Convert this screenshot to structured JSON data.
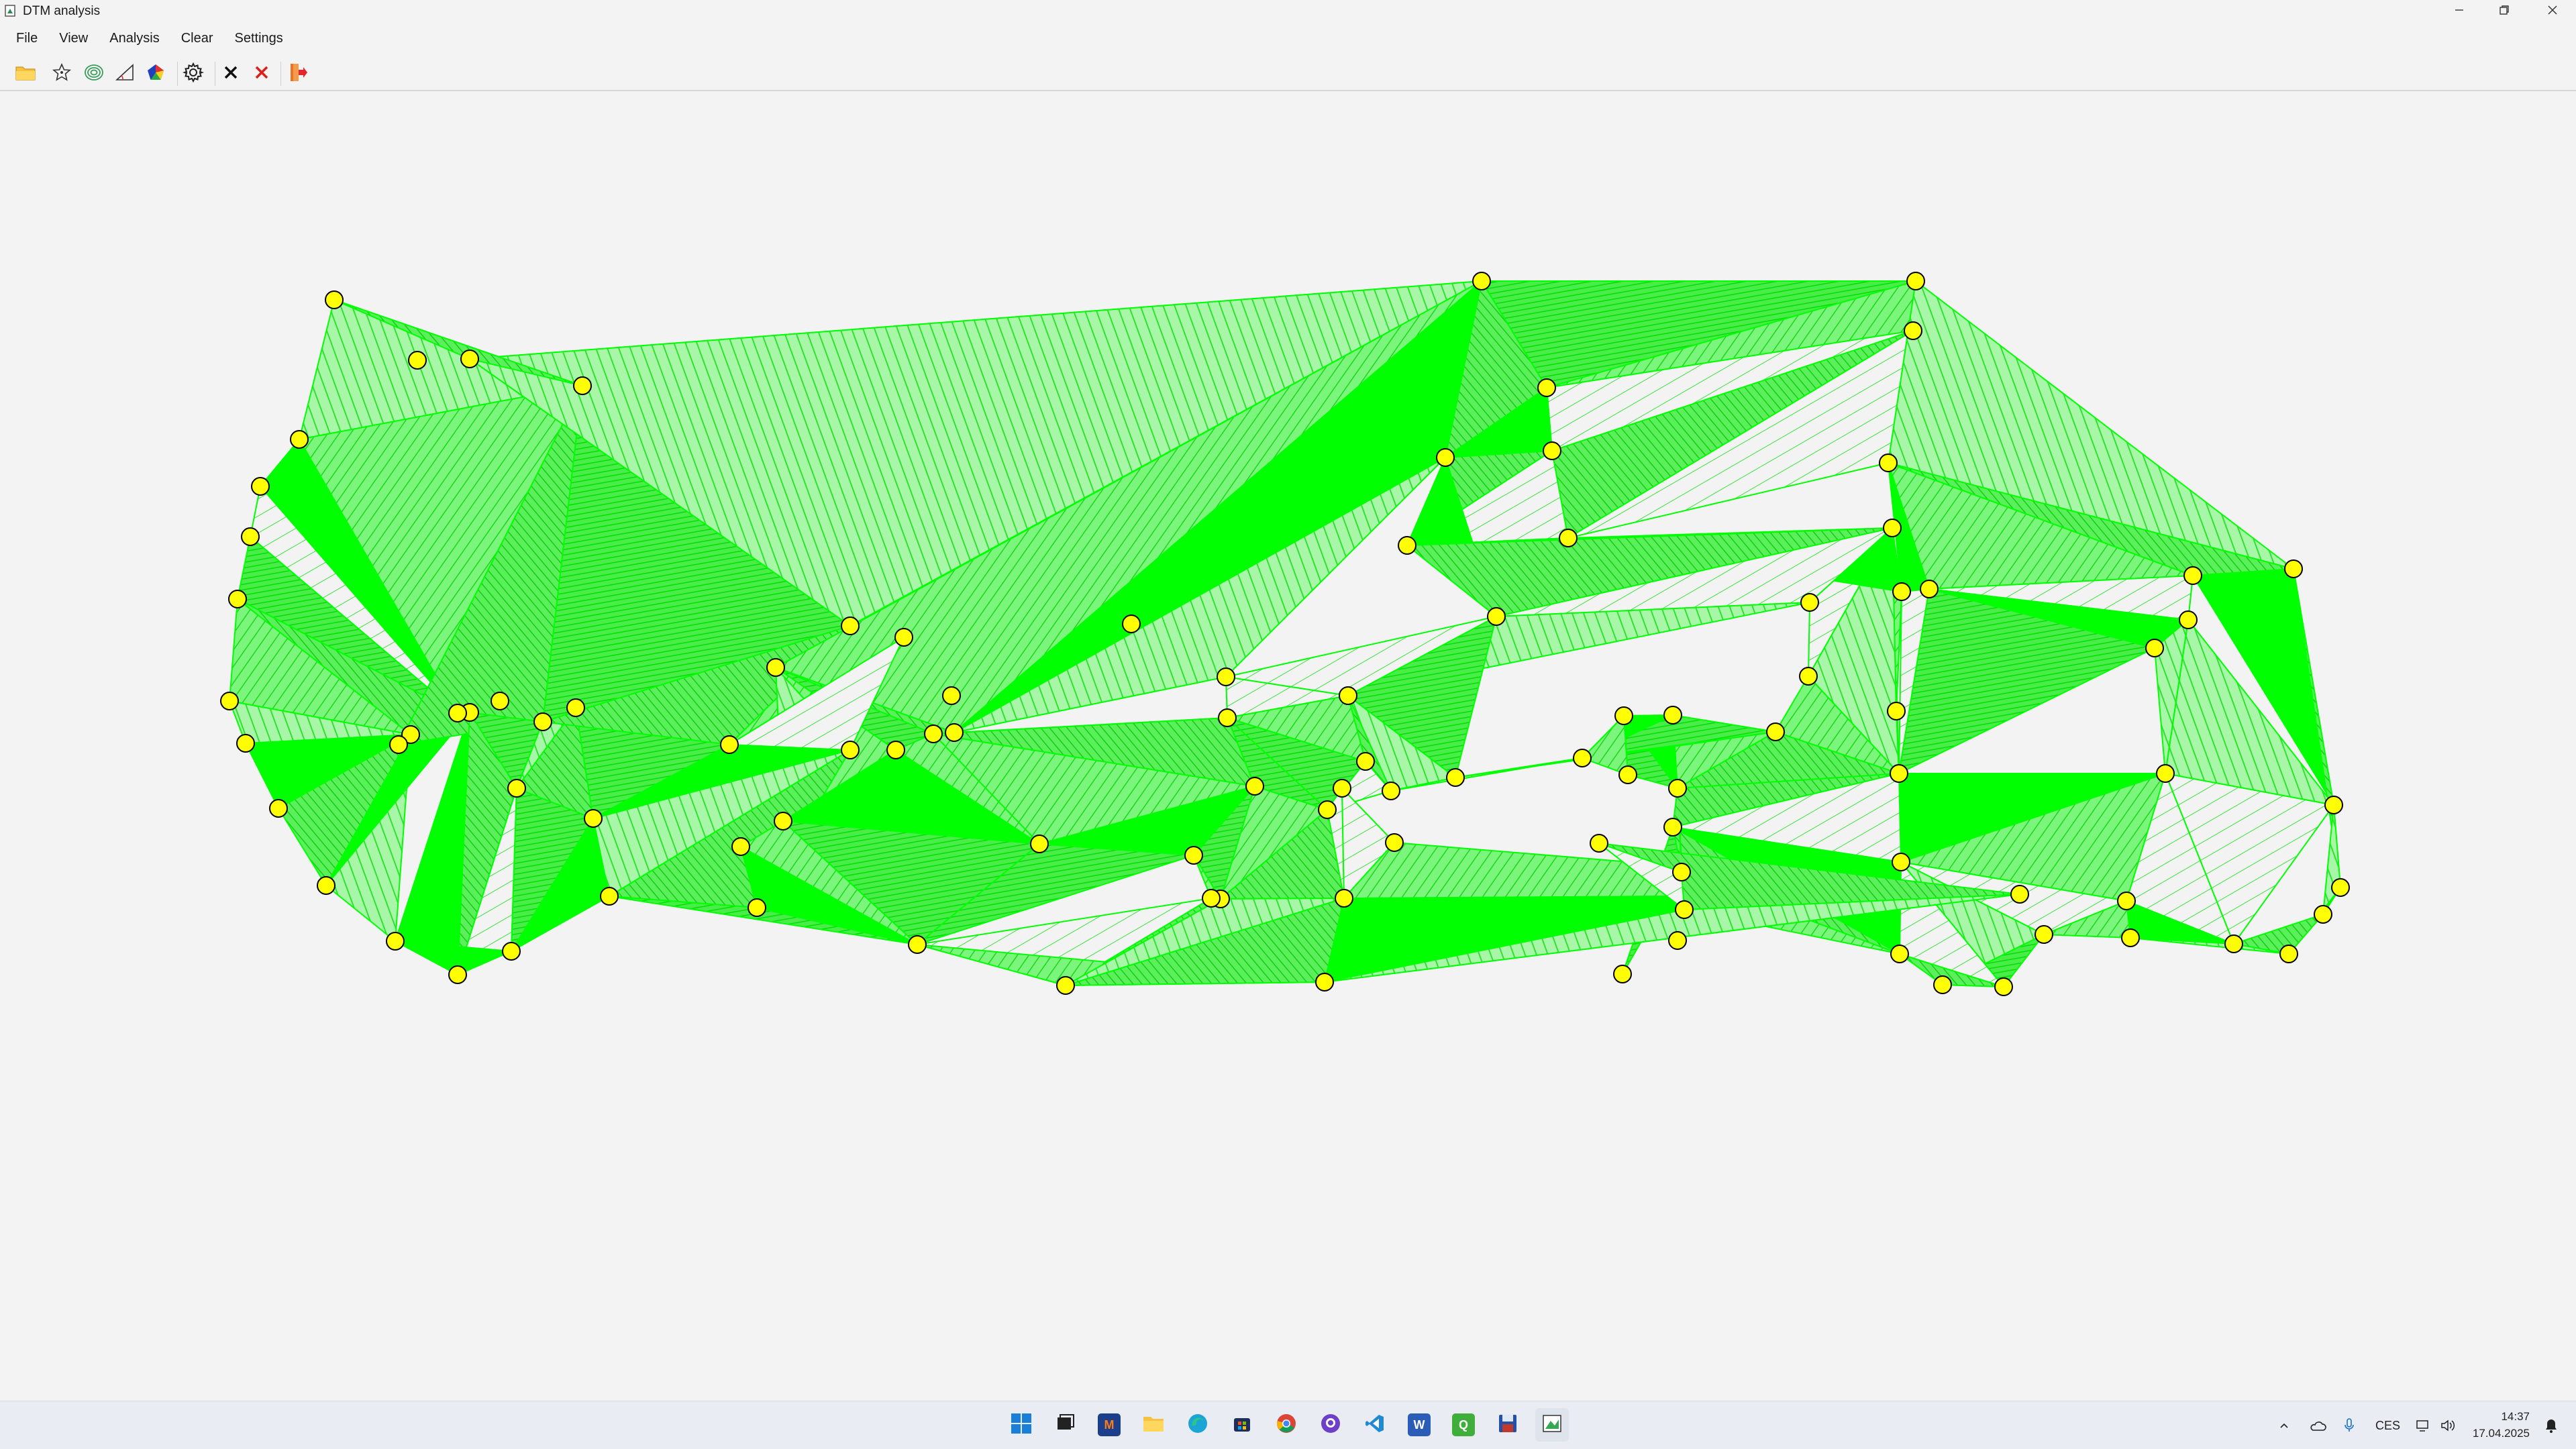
{
  "window": {
    "title": "DTM analysis"
  },
  "menu": [
    {
      "label": "File"
    },
    {
      "label": "View"
    },
    {
      "label": "Analysis"
    },
    {
      "label": "Clear"
    },
    {
      "label": "Settings"
    }
  ],
  "toolbar": {
    "tools": [
      {
        "name": "open-file-button",
        "icon": "folder-icon"
      },
      {
        "name": "draw-points-button",
        "icon": "star-points-icon"
      },
      {
        "name": "contour-lines-button",
        "icon": "contour-icon"
      },
      {
        "name": "slope-button",
        "icon": "slope-triangle-icon"
      },
      {
        "name": "exposition-button",
        "icon": "color-pentagon-icon"
      },
      {
        "name": "settings-button",
        "icon": "gear-icon"
      },
      {
        "name": "clear-results-button",
        "icon": "black-x-icon"
      },
      {
        "name": "clear-all-button",
        "icon": "red-x-icon"
      },
      {
        "name": "exit-button",
        "icon": "exit-door-icon"
      }
    ]
  },
  "canvas": {
    "fill_color": "#00ff00",
    "hatch_color": "#2fe22f",
    "background": "#f3f3f3",
    "point_fill": "#ffff00",
    "point_stroke": "#000000"
  },
  "taskbar": {
    "apps": [
      {
        "name": "start-button",
        "icon": "windows-start-icon"
      },
      {
        "name": "task-view",
        "icon": "task-view-icon"
      },
      {
        "name": "app-matlab",
        "icon": "matlab-icon"
      },
      {
        "name": "app-file-explorer",
        "icon": "folder-icon"
      },
      {
        "name": "app-edge",
        "icon": "edge-icon"
      },
      {
        "name": "app-store",
        "icon": "store-icon"
      },
      {
        "name": "app-chrome",
        "icon": "chrome-icon"
      },
      {
        "name": "app-github-desktop",
        "icon": "github-icon"
      },
      {
        "name": "app-vscode",
        "icon": "vscode-icon"
      },
      {
        "name": "app-word",
        "icon": "word-icon"
      },
      {
        "name": "app-qgis",
        "icon": "qgis-icon"
      },
      {
        "name": "app-save-tool",
        "icon": "floppy-icon"
      },
      {
        "name": "app-dtm-analysis",
        "icon": "dtm-app-icon"
      }
    ],
    "tray": {
      "language": "CES",
      "time": "14:37",
      "date": "17.04.2025"
    }
  }
}
